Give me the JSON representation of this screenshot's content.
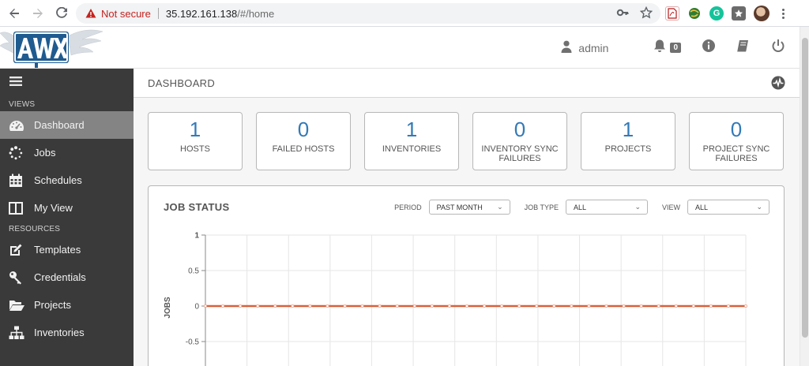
{
  "browser": {
    "security": "Not secure",
    "url_host": "35.192.161.138",
    "url_path": "/#/home"
  },
  "header": {
    "user": "admin",
    "notifications_count": "0"
  },
  "sidebar": {
    "views_label": "VIEWS",
    "resources_label": "RESOURCES",
    "items": [
      {
        "label": "Dashboard",
        "icon": "tachometer-icon"
      },
      {
        "label": "Jobs",
        "icon": "spinner-icon"
      },
      {
        "label": "Schedules",
        "icon": "calendar-icon"
      },
      {
        "label": "My View",
        "icon": "columns-icon"
      },
      {
        "label": "Templates",
        "icon": "pencil-square-icon"
      },
      {
        "label": "Credentials",
        "icon": "key-icon"
      },
      {
        "label": "Projects",
        "icon": "folder-open-icon"
      },
      {
        "label": "Inventories",
        "icon": "sitemap-icon"
      }
    ]
  },
  "page": {
    "title": "DASHBOARD"
  },
  "cards": [
    {
      "value": "1",
      "label": "HOSTS"
    },
    {
      "value": "0",
      "label": "FAILED HOSTS"
    },
    {
      "value": "1",
      "label": "INVENTORIES"
    },
    {
      "value": "0",
      "label": "INVENTORY SYNC FAILURES"
    },
    {
      "value": "1",
      "label": "PROJECTS"
    },
    {
      "value": "0",
      "label": "PROJECT SYNC FAILURES"
    }
  ],
  "job_status": {
    "title": "JOB STATUS",
    "period_label": "PERIOD",
    "period_value": "PAST MONTH",
    "job_type_label": "JOB TYPE",
    "job_type_value": "ALL",
    "view_label": "VIEW",
    "view_value": "ALL"
  },
  "chart_data": {
    "type": "line",
    "ylabel": "JOBS",
    "y_ticks": [
      "1",
      "0.5",
      "0",
      "-0.5"
    ],
    "ylim": [
      -0.75,
      1
    ],
    "grid": true,
    "series": [
      {
        "values": [
          0,
          0,
          0,
          0,
          0,
          0,
          0,
          0,
          0,
          0,
          0,
          0,
          0,
          0,
          0,
          0,
          0,
          0,
          0,
          0,
          0,
          0,
          0,
          0,
          0,
          0,
          0,
          0,
          0,
          0,
          0,
          0
        ],
        "color": "#d9603b"
      }
    ]
  },
  "colors": {
    "accent": "#337ab7",
    "sidebar_bg": "#3a3a3a",
    "sidebar_active": "#848484",
    "line": "#d9603b"
  }
}
